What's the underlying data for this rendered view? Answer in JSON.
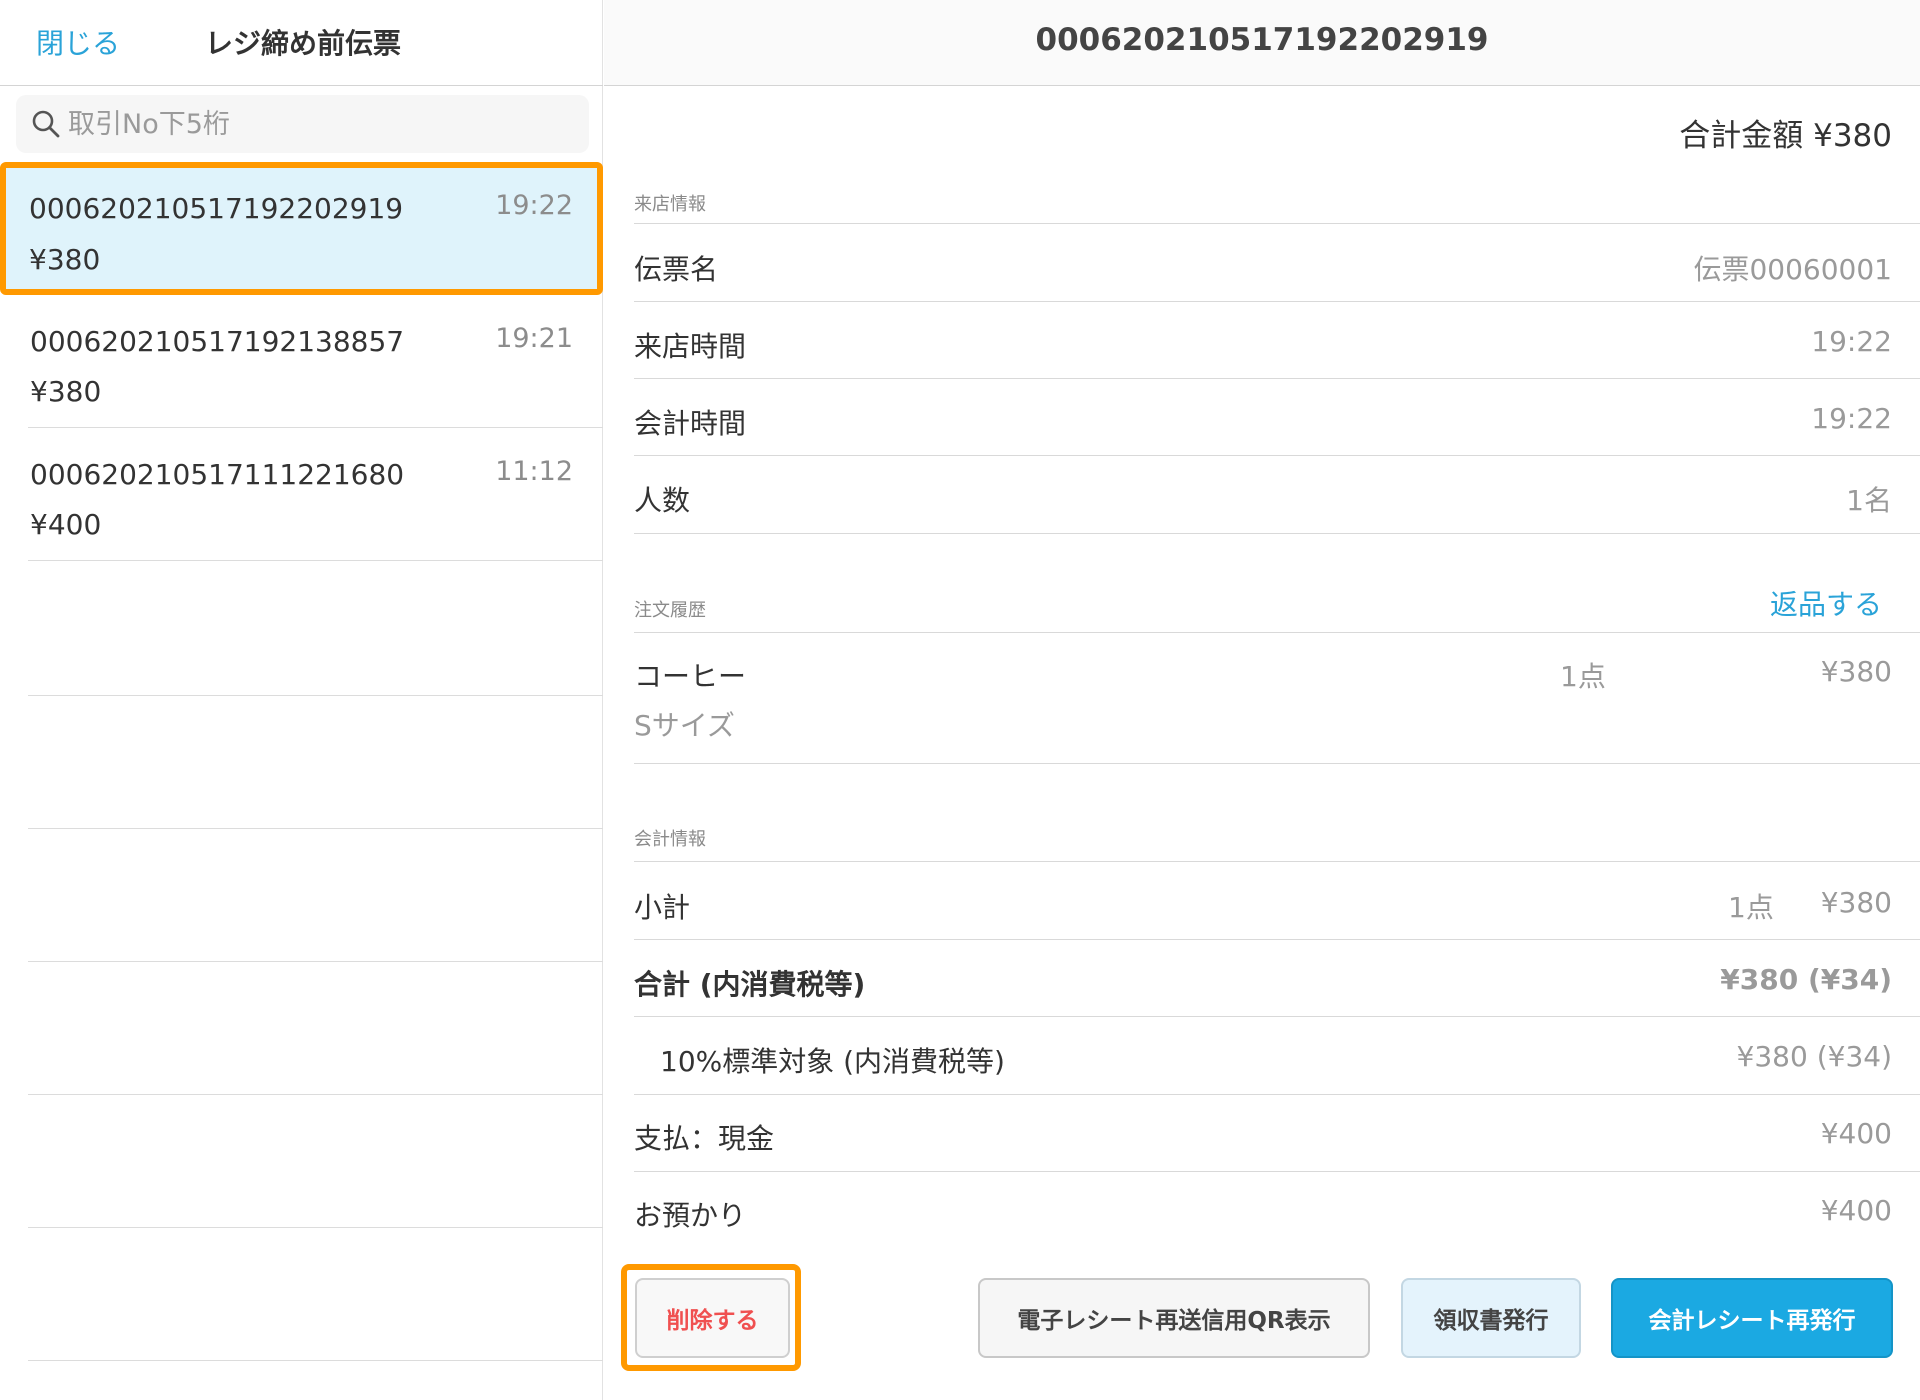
{
  "left_panel": {
    "close_label": "閉じる",
    "title": "レジ締め前伝票",
    "search_placeholder": "取引No下5桁",
    "slips": [
      {
        "number": "00062021051719220​2919",
        "amount": "¥380",
        "time": "19:22"
      },
      {
        "number": "00062021051719213​8857",
        "amount": "¥380",
        "time": "19:21"
      },
      {
        "number": "00062021051711122​1680",
        "amount": "¥400",
        "time": "11:12"
      }
    ]
  },
  "detail": {
    "title": "00062021051719220​2919",
    "total_amount": "合計金額 ¥380",
    "visit_section": {
      "label": "来店情報",
      "rows": [
        {
          "label": "伝票名",
          "value": "伝票00060001"
        },
        {
          "label": "来店時間",
          "value": "19:22"
        },
        {
          "label": "会計時間",
          "value": "19:22"
        },
        {
          "label": "人数",
          "value": "1名"
        }
      ]
    },
    "order_section": {
      "label": "注文履歴",
      "return_label": "返品する",
      "items": [
        {
          "name": "コーヒー",
          "option": "Sサイズ",
          "qty": "1点",
          "price": "¥380"
        }
      ]
    },
    "payment_section": {
      "label": "会計情報",
      "subtotal": {
        "label": "小計",
        "qty": "1点",
        "value": "¥380"
      },
      "total": {
        "label": "合計 (内消費税等)",
        "value": "¥380 (¥34)"
      },
      "tax": {
        "label": "10%標準対象 (内消費税等)",
        "value": "¥380 (¥34)"
      },
      "payment": {
        "label": "支払：現金",
        "value": "¥400"
      },
      "deposit": {
        "label": "お預かり",
        "value": "¥400"
      }
    }
  },
  "buttons": {
    "delete": "削除する",
    "qr": "電子レシート再送信用QR表示",
    "receipt": "領収書発行",
    "reissue": "会計レシート再発行"
  },
  "colors": {
    "accent": "#2aa3d8",
    "highlight": "#ff9900",
    "selected_bg": "#dff3fb",
    "primary_button": "#1ba9e2",
    "danger_text": "#f05050"
  }
}
